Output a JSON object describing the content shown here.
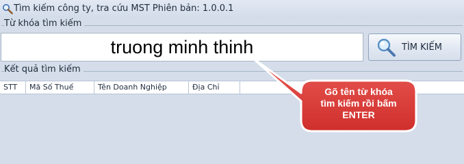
{
  "window": {
    "icon": "magnifier-icon",
    "title": "Tìm kiếm công ty, tra cứu MST  Phiên bản: 1.0.0.1"
  },
  "search_group": {
    "label": "Từ khóa tìm kiếm",
    "input_value": "truong minh thinh",
    "button_label": "TÌM KIẾM",
    "button_icon": "magnifier-icon"
  },
  "results_group": {
    "label": "Kết quả tìm kiếm",
    "columns": [
      "STT",
      "Mã Số Thuế",
      "Tên Doanh Nghiệp",
      "Địa Chỉ"
    ]
  },
  "callout": {
    "lines": [
      "Gõ tên từ khóa",
      "tìm kiếm rồi bấm",
      "ENTER"
    ],
    "color": "#e0403d"
  }
}
